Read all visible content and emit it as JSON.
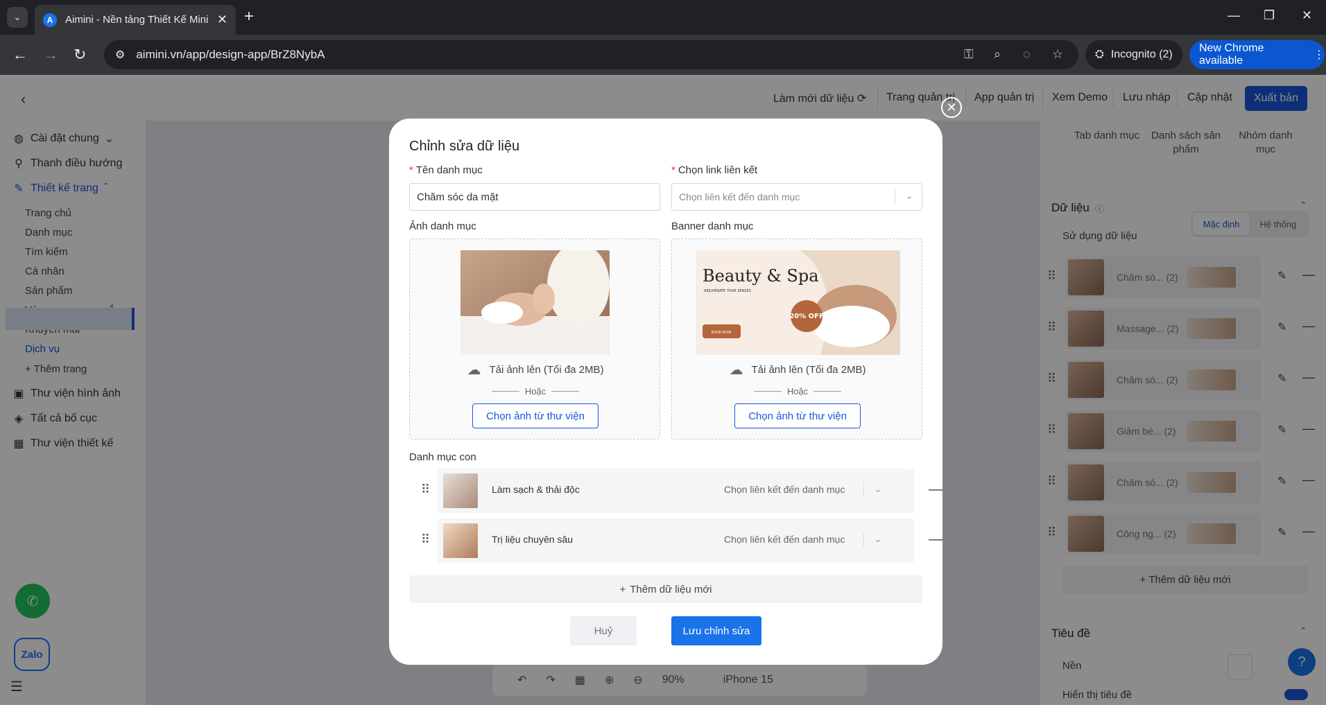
{
  "browser": {
    "tab_title": "Aimini - Nền tảng Thiết Kế Mini",
    "favicon_letter": "A",
    "url": "aimini.vn/app/design-app/BrZ8NybA",
    "incognito_label": "Incognito (2)",
    "update_label": "New Chrome available",
    "accent": "#0b57d0"
  },
  "header": {
    "refresh": "Làm mới dữ liệu",
    "admin_page": "Trang quản trị",
    "admin_app": "App quản trị",
    "demo": "Xem Demo",
    "draft": "Lưu nháp",
    "update": "Cập nhật",
    "publish": "Xuất bản"
  },
  "sidebar": {
    "general": "Cài đặt chung",
    "nav": "Thanh điều hướng",
    "design": "Thiết kế trang",
    "pages": [
      "Trang chủ",
      "Danh mục",
      "Tìm kiếm",
      "Cá nhân",
      "Sản phẩm",
      "Vòng quay may mắn",
      "Khuyến mãi",
      "Dịch vụ"
    ],
    "add_page": "+ Thêm trang",
    "image_library": "Thư viện hình ảnh",
    "all_layouts": "Tất cả bố cục",
    "design_library": "Thư viện thiết kế"
  },
  "canvas": {
    "zoom": "90%",
    "device": "iPhone 15"
  },
  "right_panel": {
    "tabs": [
      "Tab danh mục",
      "Danh sách sản phẩm",
      "Nhóm danh mục"
    ],
    "data_title": "Dữ liệu",
    "use_data": "Sử dụng dữ liệu",
    "seg_default": "Mặc định",
    "seg_system": "Hệ thống",
    "rows": [
      {
        "name": "Chăm só...",
        "count": "(2)"
      },
      {
        "name": "Massage...",
        "count": "(2)"
      },
      {
        "name": "Chăm só...",
        "count": "(2)"
      },
      {
        "name": "Giảm bé...",
        "count": "(2)"
      },
      {
        "name": "Chăm só...",
        "count": "(2)"
      },
      {
        "name": "Công ng...",
        "count": "(2)"
      }
    ],
    "add_data": "Thêm dữ liệu mới",
    "title_section": "Tiêu đề",
    "background": "Nền",
    "show_title": "Hiển thị tiêu đề"
  },
  "floating": {
    "zalo": "Zalo",
    "help": "?"
  },
  "modal": {
    "title": "Chỉnh sửa dữ liệu",
    "name_label": "Tên danh mục",
    "name_value": "Chăm sóc da mặt",
    "link_label": "Chọn link liên kết",
    "link_placeholder": "Chọn liên kết đến danh mục",
    "image_label": "Ảnh danh mục",
    "banner_label": "Banner danh mục",
    "upload_text": "Tải ảnh lên (Tối đa 2MB)",
    "or_text": "Hoặc",
    "library_btn": "Chọn ảnh từ thư viện",
    "banner_title": "Beauty & Spa",
    "banner_sub": "REJUVENATE YOUR SENSES",
    "banner_badge": "20% OFF",
    "banner_cta": "BOOK NOW",
    "sub_label": "Danh mục con",
    "sub_items": [
      {
        "name": "Làm sạch & thải độc",
        "link": "Chọn liên kết đến danh mục"
      },
      {
        "name": "Trị liệu chuyên sâu",
        "link": "Chọn liên kết đến danh mục"
      }
    ],
    "add_data": "Thêm dữ liệu mới",
    "cancel": "Huỷ",
    "save": "Lưu chỉnh sửa"
  }
}
